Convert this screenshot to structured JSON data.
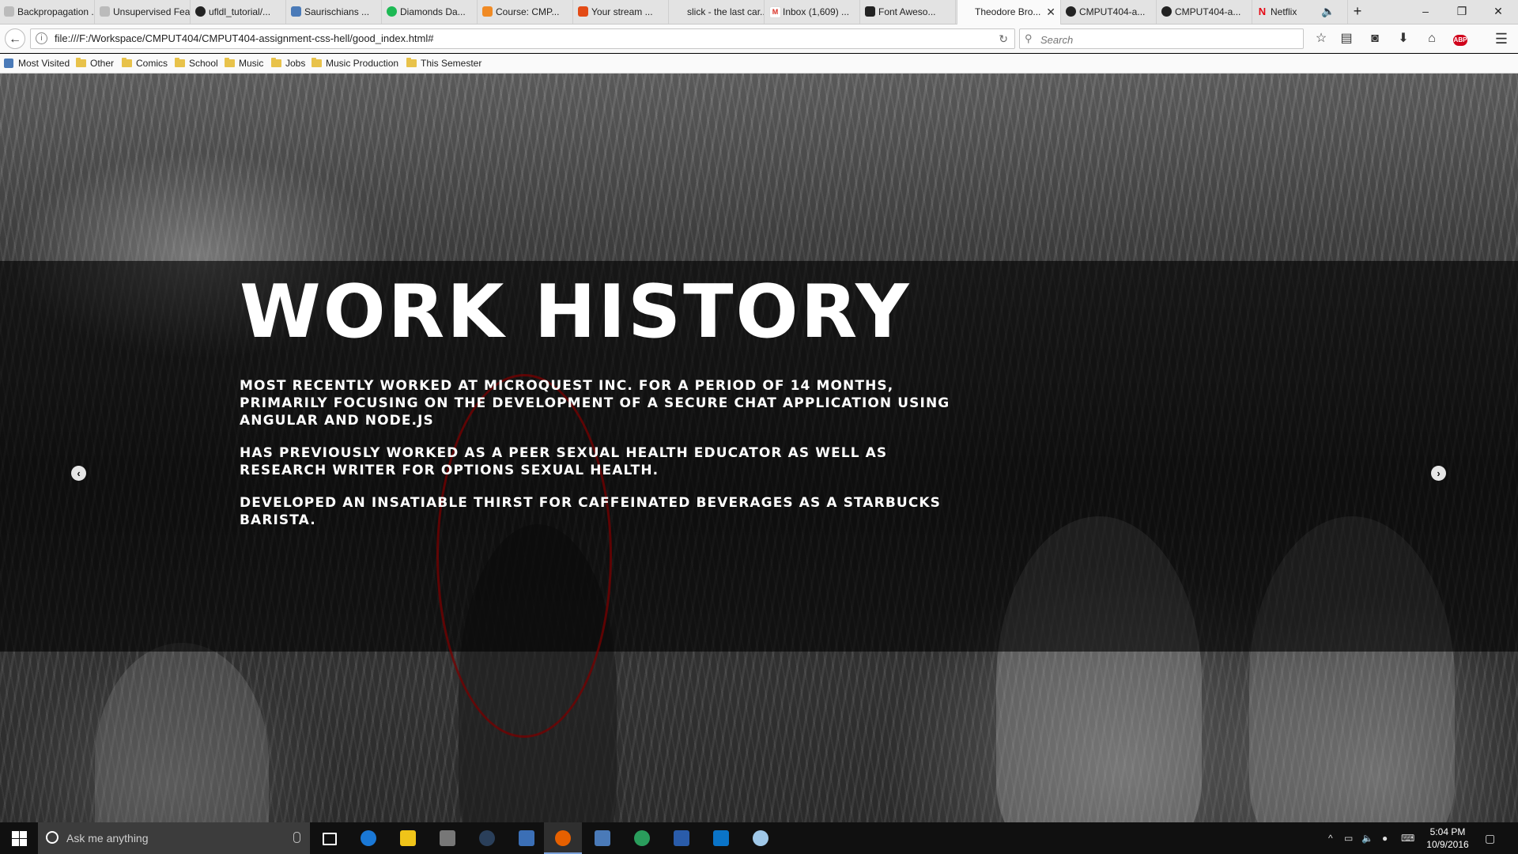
{
  "browser": {
    "tabs": [
      {
        "title": "Backpropagation ...",
        "icon": "page-icon",
        "color": "#bbbbbb"
      },
      {
        "title": "Unsupervised Fea...",
        "icon": "page-icon",
        "color": "#bbbbbb"
      },
      {
        "title": "ufldl_tutorial/...",
        "icon": "github-icon",
        "color": "#222222"
      },
      {
        "title": "Saurischians ...",
        "icon": "link-icon",
        "color": "#4a7ab8"
      },
      {
        "title": "Diamonds Da...",
        "icon": "spotify-icon",
        "color": "#1db954"
      },
      {
        "title": "Course: CMP...",
        "icon": "moodle-icon",
        "color": "#f08a24"
      },
      {
        "title": "Your stream ...",
        "icon": "stream-icon",
        "color": "#e34b16"
      },
      {
        "title": "slick - the last car...",
        "icon": "page-icon",
        "color": "#cccccc"
      },
      {
        "title": "Inbox (1,609) ...",
        "icon": "gmail-icon",
        "color": "#d93025"
      },
      {
        "title": "Font Aweso...",
        "icon": "fontawesome-icon",
        "color": "#222222"
      },
      {
        "title": "Theodore Bro...",
        "icon": "page-icon",
        "color": "#ffffff"
      },
      {
        "title": "CMPUT404-a...",
        "icon": "github-icon",
        "color": "#222222"
      },
      {
        "title": "CMPUT404-a...",
        "icon": "github-icon",
        "color": "#222222"
      },
      {
        "title": "Netflix",
        "icon": "netflix-icon",
        "color": "#e50914"
      }
    ],
    "url": "file:///F:/Workspace/CMPUT404/CMPUT404-assignment-css-hell/good_index.html#",
    "search_placeholder": "Search",
    "bookmarks": [
      "Most Visited",
      "Other",
      "Comics",
      "School",
      "Music",
      "Jobs",
      "Music Production",
      "This Semester"
    ]
  },
  "slide": {
    "title": "WORK HISTORY",
    "paragraphs": [
      "MOST RECENTLY WORKED AT MICROQUEST INC. FOR A PERIOD OF 14 MONTHS, PRIMARILY FOCUSING ON THE DEVELOPMENT OF A SECURE CHAT APPLICATION USING ANGULAR AND NODE.JS",
      "HAS PREVIOUSLY WORKED AS A PEER SEXUAL HEALTH EDUCATOR AS WELL AS RESEARCH WRITER FOR OPTIONS SEXUAL HEALTH.",
      "DEVELOPED AN INSATIABLE THIRST FOR CAFFEINATED BEVERAGES AS A STARBUCKS BARISTA."
    ],
    "prev_icon": "chevron-left-icon",
    "next_icon": "chevron-right-icon"
  },
  "taskbar": {
    "search_placeholder": "Ask me anything",
    "apps": [
      {
        "name": "task-view-icon",
        "color": "#ffffff"
      },
      {
        "name": "edge-icon",
        "color": "#1a78d6"
      },
      {
        "name": "file-explorer-icon",
        "color": "#f0c419"
      },
      {
        "name": "livesplit-icon",
        "color": "#777777"
      },
      {
        "name": "steam-icon",
        "color": "#1b2838"
      },
      {
        "name": "visual-studio-icon",
        "color": "#3b6fb6"
      },
      {
        "name": "firefox-icon",
        "color": "#e66000"
      },
      {
        "name": "network-icon",
        "color": "#4a7ab8"
      },
      {
        "name": "sourcetree-icon",
        "color": "#2a9d5c"
      },
      {
        "name": "powershell-icon",
        "color": "#2a5caa"
      },
      {
        "name": "photoshop-icon",
        "color": "#0a74c8"
      },
      {
        "name": "paint-icon",
        "color": "#a0c8e8"
      }
    ],
    "time": "5:04 PM",
    "date": "10/9/2016"
  }
}
